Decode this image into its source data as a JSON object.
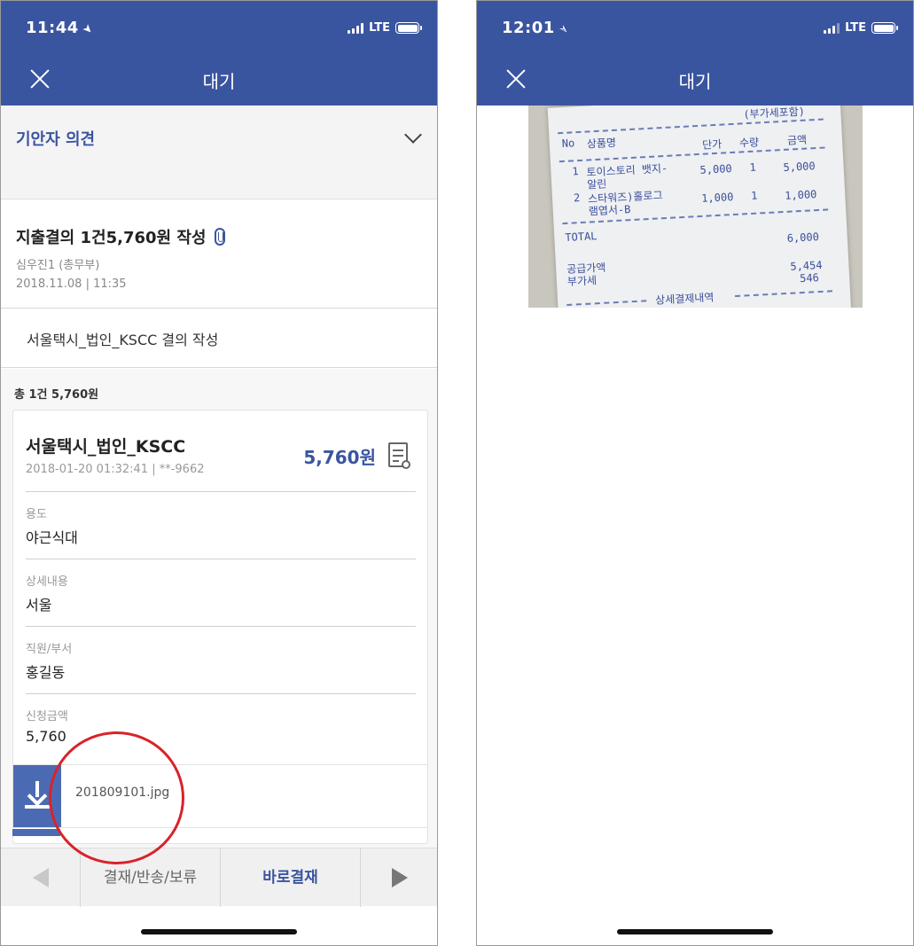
{
  "left_screen": {
    "status": {
      "time": "11:44",
      "network": "LTE"
    },
    "nav": {
      "title": "대기"
    },
    "opinion": {
      "label": "기안자 의견"
    },
    "document": {
      "title": "지출결의 1건5,760원 작성",
      "author": "심우진1 (총무부)",
      "date": "2018.11.08 | 11:35"
    },
    "subject": "서울택시_법인_KSCC 결의 작성",
    "summary": "총 1건 5,760원",
    "card": {
      "merchant": "서울택시_법인_KSCC",
      "meta": "2018-01-20 01:32:41 | **-9662",
      "amount": "5,760원",
      "fields": [
        {
          "label": "용도",
          "value": "야근식대"
        },
        {
          "label": "상세내용",
          "value": "서울"
        },
        {
          "label": "직원/부서",
          "value": "홍길동"
        },
        {
          "label": "신청금액",
          "value": "5,760"
        }
      ]
    },
    "attachment": {
      "filename": "201809101.jpg"
    },
    "toolbar": {
      "approve_label": "결재/반송/보류",
      "direct_label": "바로결재"
    }
  },
  "right_screen": {
    "status": {
      "time": "12:01",
      "network": "LTE"
    },
    "nav": {
      "title": "대기"
    },
    "receipt": {
      "vat_note": "(부가세포함)",
      "headers": [
        "No",
        "상품명",
        "단가",
        "수량",
        "금액"
      ],
      "items": [
        {
          "no": "1",
          "name": "토이스토리 뱃지-",
          "name2": "알린",
          "price": "5,000",
          "qty": "1",
          "amount": "5,000"
        },
        {
          "no": "2",
          "name": "스타워즈)홀로그",
          "name2": "램엽서-B",
          "price": "1,000",
          "qty": "1",
          "amount": "1,000"
        }
      ],
      "total_label": "TOTAL",
      "total_value": "6,000",
      "supply_label": "공급가액",
      "supply_value": "5,454",
      "vat_label": "부가세",
      "vat_value": "546",
      "detail_label": "상세결제내역"
    }
  },
  "colors": {
    "brand": "#3a55a0",
    "highlight": "#d8232a"
  }
}
